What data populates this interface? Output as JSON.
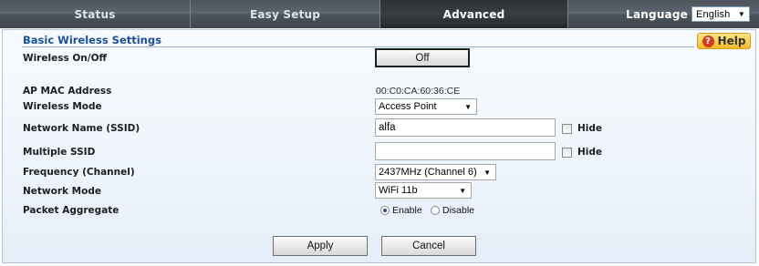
{
  "nav": {
    "tabs": [
      {
        "label": "Status"
      },
      {
        "label": "Easy Setup"
      },
      {
        "label": "Advanced",
        "active": true
      }
    ],
    "language_label": "Language",
    "language_value": "English"
  },
  "section": {
    "title": "Basic Wireless Settings",
    "help_label": "Help"
  },
  "fields": {
    "wireless_onoff": {
      "label": "Wireless On/Off",
      "button": "Off"
    },
    "ap_mac": {
      "label": "AP MAC Address",
      "value": "00:C0:CA:60:36:CE"
    },
    "wireless_mode": {
      "label": "Wireless Mode",
      "value": "Access Point"
    },
    "ssid": {
      "label": "Network Name (SSID)",
      "value": "alfa",
      "hide_label": "Hide"
    },
    "multi_ssid": {
      "label": "Multiple SSID",
      "value": "",
      "hide_label": "Hide"
    },
    "frequency": {
      "label": "Frequency (Channel)",
      "value": "2437MHz (Channel 6)"
    },
    "network_mode": {
      "label": "Network Mode",
      "value": "WiFi 11b"
    },
    "packet_aggregate": {
      "label": "Packet Aggregate",
      "options": [
        "Enable",
        "Disable"
      ],
      "selected": "Enable"
    }
  },
  "actions": {
    "apply": "Apply",
    "cancel": "Cancel"
  },
  "colors": {
    "accent": "#1a4f9a",
    "help": "#f4b925",
    "nav": "#4c545c"
  }
}
